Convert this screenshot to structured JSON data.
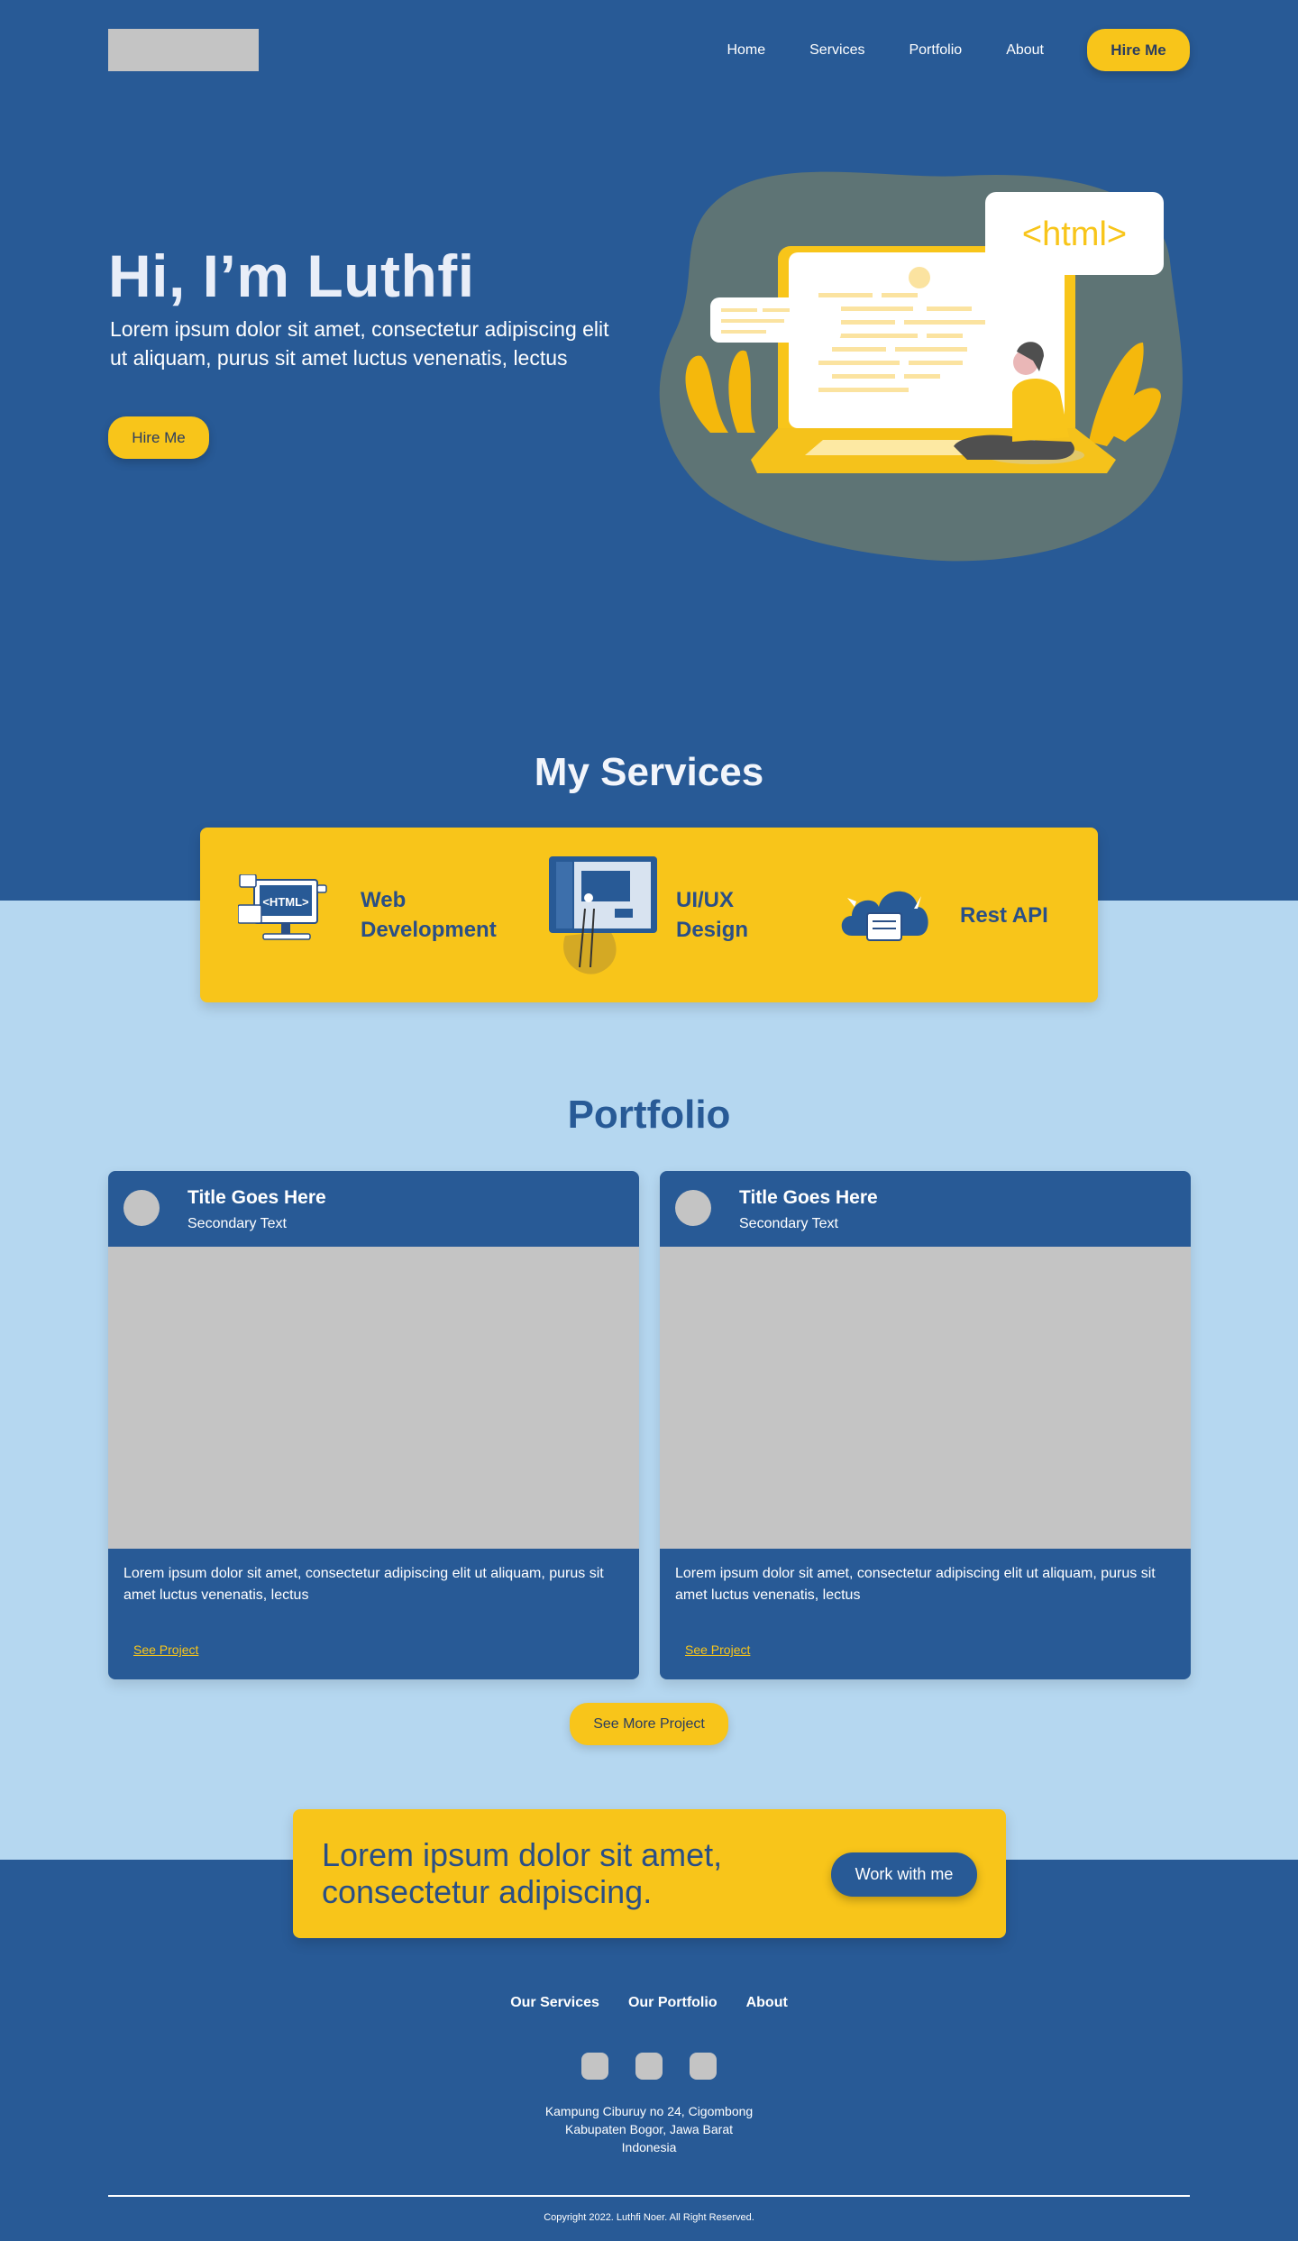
{
  "nav": {
    "items": [
      "Home",
      "Services",
      "Portfolio",
      "About"
    ],
    "hire_button": "Hire Me"
  },
  "hero": {
    "title": "Hi, I’m Luthfi",
    "subtitle": "Lorem ipsum dolor sit amet, consectetur adipiscing elit ut aliquam, purus sit amet luctus venenatis, lectus",
    "button": "Hire Me",
    "illustration_text": "<html>"
  },
  "services": {
    "title": "My Services",
    "items": [
      {
        "label": "Web Development",
        "icon": "web-development-icon",
        "icon_text": "<HTML>"
      },
      {
        "label": "UI/UX Design",
        "icon": "ui-ux-design-icon"
      },
      {
        "label": "Rest API",
        "icon": "rest-api-icon"
      }
    ]
  },
  "portfolio": {
    "title": "Portfolio",
    "cards": [
      {
        "title": "Title Goes Here",
        "secondary": "Secondary Text",
        "description": "Lorem ipsum dolor sit amet, consectetur adipiscing elit ut aliquam, purus sit amet luctus venenatis, lectus",
        "link": "See Project"
      },
      {
        "title": "Title Goes Here",
        "secondary": "Secondary Text",
        "description": "Lorem ipsum dolor sit amet, consectetur adipiscing elit ut aliquam, purus sit amet luctus venenatis, lectus",
        "link": "See Project"
      }
    ],
    "see_more": "See More Project"
  },
  "cta": {
    "text": "Lorem ipsum dolor sit amet, consectetur adipiscing.",
    "button": "Work with me"
  },
  "footer": {
    "links": [
      "Our Services",
      "Our Portfolio",
      "About"
    ],
    "address_lines": [
      "Kampung Ciburuy no 24, Cigombong",
      "Kabupaten Bogor, Jawa Barat",
      "Indonesia"
    ],
    "copyright": "Copyright 2022. Luthfi Noer. All Right Reserved."
  },
  "colors": {
    "primary_blue": "#285a96",
    "accent_yellow": "#f8c51a",
    "light_blue": "#b5d7f0",
    "placeholder_gray": "#c4c4c4"
  }
}
